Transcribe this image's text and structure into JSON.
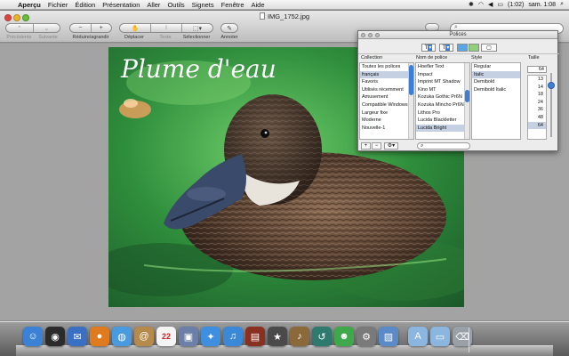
{
  "menubar": {
    "apple_glyph": "",
    "items": [
      "Aperçu",
      "Fichier",
      "Édition",
      "Présentation",
      "Aller",
      "Outils",
      "Signets",
      "Fenêtre",
      "Aide"
    ],
    "battery": "(1:02)",
    "clock": "sam. 1:08",
    "status_icons": [
      "bluetooth-icon",
      "wifi-icon",
      "volume-icon",
      "battery-icon",
      "spotlight-icon"
    ]
  },
  "window": {
    "title": "IMG_1752.jpg",
    "toolbar": {
      "previous_label": "Précédente",
      "next_label": "Suivante",
      "zoom_label": "Réduire/agrandir",
      "move_label": "Déplacer",
      "text_label": "Texte",
      "select_label": "Sélectionner",
      "annotate_label": "Annoter",
      "zoom_minus": "−",
      "zoom_plus": "+"
    },
    "search": {
      "placeholder": ""
    }
  },
  "photo": {
    "overlay_text": "Plume d'eau"
  },
  "statusbar": {
    "aa_label": "Aa"
  },
  "fonts_panel": {
    "title": "Polices",
    "headers": {
      "collection": "Collection",
      "family": "Nom de police",
      "style": "Style",
      "size": "Taille"
    },
    "collections": [
      "Toutes les polices",
      "français",
      "Favoris",
      "Utilisés récemment",
      "Amusement",
      "Compatible Windows",
      "Largeur fixe",
      "Moderne",
      "Nouvelle-1"
    ],
    "collection_selected": 1,
    "families": [
      "Hoefler Text",
      "Impact",
      "Imprint MT Shadow",
      "Kino MT",
      "Kozuka Gothic Pr6N",
      "Kozuka Mincho Pr6N",
      "Lithos Pro",
      "Lucida Blackletter",
      "Lucida Bright"
    ],
    "family_selected": 8,
    "styles": [
      "Regular",
      "Italic",
      "Demibold",
      "Demibold Italic"
    ],
    "style_selected": 1,
    "size_value": "64",
    "sizes": [
      "13",
      "14",
      "18",
      "24",
      "36",
      "48",
      "64"
    ],
    "size_selected": 6,
    "bottom_buttons": [
      "+",
      "−"
    ],
    "search_placeholder": ""
  },
  "dock": {
    "apps": [
      {
        "name": "finder-icon",
        "color": "#3b82d6",
        "glyph": "☺"
      },
      {
        "name": "dashboard-icon",
        "color": "#2b2b2b",
        "glyph": "◉"
      },
      {
        "name": "mail-icon",
        "color": "#3a6fc4",
        "glyph": "✉"
      },
      {
        "name": "firefox-icon",
        "color": "#e07a1f",
        "glyph": "●"
      },
      {
        "name": "ichat-icon",
        "color": "#4a9ae0",
        "glyph": "◍"
      },
      {
        "name": "address-book-icon",
        "color": "#b58a4a",
        "glyph": "@"
      },
      {
        "name": "ical-icon",
        "color": "#f4f4f4",
        "glyph": "22"
      },
      {
        "name": "iphoto-icon",
        "color": "#6b7fa8",
        "glyph": "▣"
      },
      {
        "name": "safari-icon",
        "color": "#3f8fe0",
        "glyph": "✦"
      },
      {
        "name": "itunes-icon",
        "color": "#3a88d8",
        "glyph": "♫"
      },
      {
        "name": "photo-booth-icon",
        "color": "#8a3020",
        "glyph": "▤"
      },
      {
        "name": "imovie-icon",
        "color": "#4a4a4a",
        "glyph": "★"
      },
      {
        "name": "garageband-icon",
        "color": "#8a6a3a",
        "glyph": "♪"
      },
      {
        "name": "time-machine-icon",
        "color": "#2e7a6e",
        "glyph": "↺"
      },
      {
        "name": "messenger-icon",
        "color": "#3ea84a",
        "glyph": "☻"
      },
      {
        "name": "system-preferences-icon",
        "color": "#7a7a7a",
        "glyph": "⚙"
      },
      {
        "name": "preview-icon",
        "color": "#5a8ac8",
        "glyph": "▧"
      },
      {
        "name": "applications-folder-icon",
        "color": "#8bb6e0",
        "glyph": "A"
      },
      {
        "name": "documents-folder-icon",
        "color": "#8bb6e0",
        "glyph": "▭"
      },
      {
        "name": "trash-icon",
        "color": "#9aa0a8",
        "glyph": "⌫"
      }
    ]
  }
}
